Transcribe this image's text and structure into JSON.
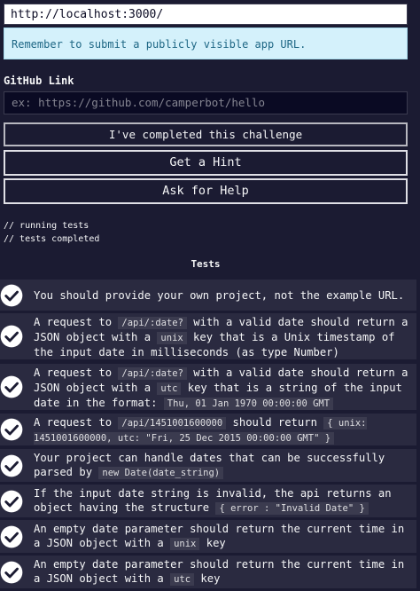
{
  "url_field": {
    "value": "http://localhost:3000/"
  },
  "alert": {
    "text": "Remember to submit a publicly visible app URL."
  },
  "github": {
    "label": "GitHub Link",
    "placeholder": "ex: https://github.com/camperbot/hello"
  },
  "buttons": {
    "complete": "I've completed this challenge",
    "hint": "Get a Hint",
    "help": "Ask for Help"
  },
  "log": [
    "// running tests",
    "// tests completed"
  ],
  "tests_title": "Tests",
  "tests": [
    {
      "parts": [
        {
          "t": "You should provide your own project, not the example URL."
        }
      ]
    },
    {
      "parts": [
        {
          "t": "A request to "
        },
        {
          "c": "/api/:date?"
        },
        {
          "t": " with a valid date should return a JSON object with a "
        },
        {
          "c": "unix"
        },
        {
          "t": " key that is a Unix timestamp of the input date in milliseconds (as type Number)"
        }
      ]
    },
    {
      "parts": [
        {
          "t": "A request to "
        },
        {
          "c": "/api/:date?"
        },
        {
          "t": " with a valid date should return a JSON object with a "
        },
        {
          "c": "utc"
        },
        {
          "t": " key that is a string of the input date in the format: "
        },
        {
          "c": "Thu, 01 Jan 1970 00:00:00 GMT"
        }
      ]
    },
    {
      "parts": [
        {
          "t": "A request to "
        },
        {
          "c": "/api/1451001600000"
        },
        {
          "t": " should return "
        },
        {
          "c": "{ unix: 1451001600000, utc: \"Fri, 25 Dec 2015 00:00:00 GMT\" }"
        }
      ]
    },
    {
      "parts": [
        {
          "t": "Your project can handle dates that can be successfully parsed by "
        },
        {
          "c": "new Date(date_string)"
        }
      ]
    },
    {
      "parts": [
        {
          "t": "If the input date string is invalid, the api returns an object having the structure "
        },
        {
          "c": "{ error : \"Invalid Date\" }"
        }
      ]
    },
    {
      "parts": [
        {
          "t": "An empty date parameter should return the current time in a JSON object with a "
        },
        {
          "c": "unix"
        },
        {
          "t": " key"
        }
      ]
    },
    {
      "parts": [
        {
          "t": "An empty date parameter should return the current time in a JSON object with a "
        },
        {
          "c": "utc"
        },
        {
          "t": " key"
        }
      ]
    }
  ],
  "icons": {
    "test_status": "checkmark-circle-icon"
  },
  "colors": {
    "background": "#1b1b32",
    "alert_bg": "#d4f1fb",
    "alert_text": "#1e6785",
    "test_row": "#2a2a40"
  }
}
